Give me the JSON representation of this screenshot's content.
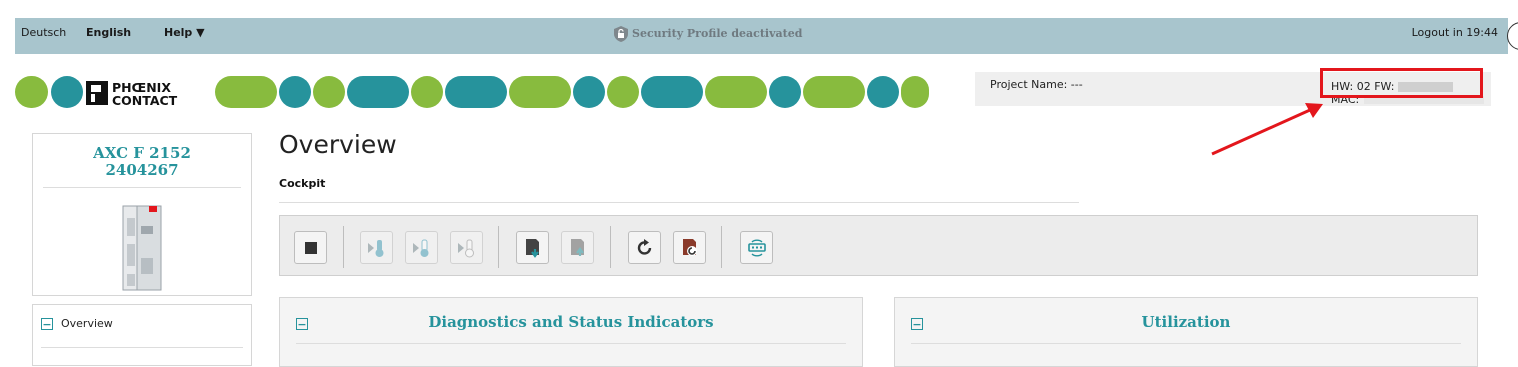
{
  "topbar": {
    "lang_de": "Deutsch",
    "lang_en": "English",
    "help": "Help ▼",
    "security_profile": "Security Profile deactivated",
    "logout": "Logout in 19:44"
  },
  "project": {
    "name_label": "Project Name: ---",
    "hw_fw": "HW: 02 FW:",
    "mac": "MAC:"
  },
  "device": {
    "model": "AXC F 2152",
    "article": "2404267"
  },
  "nav": {
    "items": [
      {
        "label": "Overview"
      }
    ]
  },
  "main": {
    "title": "Overview",
    "subtitle": "Cockpit"
  },
  "toolbar": {
    "buttons": [
      {
        "icon": "stop-icon",
        "enabled": true
      },
      {
        "icon": "cold-start-icon",
        "enabled": false
      },
      {
        "icon": "warm-start-icon",
        "enabled": false
      },
      {
        "icon": "hot-start-icon",
        "enabled": false
      },
      {
        "icon": "sd-card-download-icon",
        "enabled": true
      },
      {
        "icon": "sd-card-upload-icon",
        "enabled": false
      },
      {
        "icon": "reboot-icon",
        "enabled": true
      },
      {
        "icon": "reset-icon",
        "enabled": true
      },
      {
        "icon": "network-refresh-icon",
        "enabled": true
      }
    ]
  },
  "panels": {
    "diagnostics": "Diagnostics and Status Indicators",
    "utilization": "Utilization"
  },
  "colors": {
    "accent_teal": "#26939c",
    "accent_green": "#88bb3e",
    "topbar": "#a8c5cd",
    "highlight_red": "#e3161c"
  }
}
